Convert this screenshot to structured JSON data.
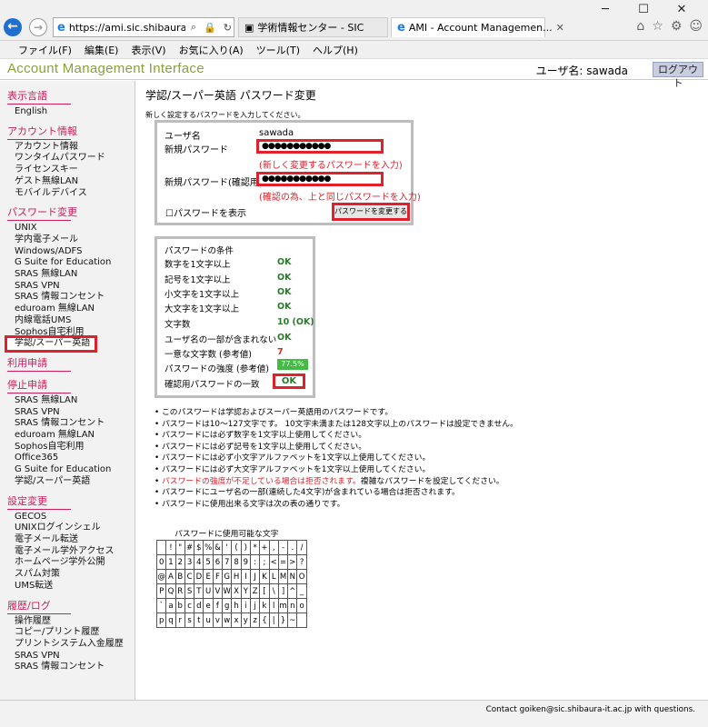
{
  "browser": {
    "window_controls": [
      "─",
      "☐",
      "✕"
    ],
    "address": "https://ami.sic.shibaura...",
    "tabs": [
      {
        "label": "学術情報センター - SIC"
      },
      {
        "label": "AMI - Account Managemen..."
      }
    ],
    "menu": [
      "ファイル(F)",
      "編集(E)",
      "表示(V)",
      "お気に入り(A)",
      "ツール(T)",
      "ヘルプ(H)"
    ]
  },
  "header": {
    "title": "Account Management Interface",
    "user_label": "ユーザ名: sawada",
    "logout": "ログアウト"
  },
  "sidebar": [
    {
      "title": "表示言語",
      "items": [
        "English"
      ]
    },
    {
      "title": "アカウント情報",
      "items": [
        "アカウント情報",
        "ワンタイムパスワード",
        "ライセンスキー",
        "ゲスト無線LAN",
        "モバイルデバイス"
      ]
    },
    {
      "title": "パスワード変更",
      "items": [
        "UNIX",
        "学内電子メール",
        "Windows/ADFS",
        "G Suite for Education",
        "SRAS 無線LAN",
        "SRAS VPN",
        "SRAS 情報コンセント",
        "eduroam 無線LAN",
        "内線電話UMS",
        "Sophos自宅利用",
        "学認/スーパー英語"
      ]
    },
    {
      "title": "利用申請",
      "items": []
    },
    {
      "title": "停止申請",
      "items": [
        "SRAS 無線LAN",
        "SRAS VPN",
        "SRAS 情報コンセント",
        "eduroam 無線LAN",
        "Sophos自宅利用",
        "Office365",
        "G Suite for Education",
        "学認/スーパー英語"
      ]
    },
    {
      "title": "設定変更",
      "items": [
        "GECOS",
        "UNIXログインシェル",
        "電子メール転送",
        "電子メール学外アクセス",
        "ホームページ学外公開",
        "スパム対策",
        "UMS転送"
      ]
    },
    {
      "title": "履歴/ログ",
      "items": [
        "操作履歴",
        "コピー/プリント履歴",
        "プリントシステム入金履歴",
        "SRAS VPN",
        "SRAS 情報コンセント"
      ]
    }
  ],
  "main": {
    "title": "学認/スーパー英語 パスワード変更",
    "instruction": "新しく設定するパスワードを入力してください。",
    "form": {
      "username_label": "ユーザ名",
      "username_value": "sawada",
      "new_pw_label": "新規パスワード",
      "new_pw_value": "●●●●●●●●●●●",
      "new_pw_hint": "(新しく変更するパスワードを入力)",
      "confirm_pw_label": "新規パスワード(確認用)",
      "confirm_pw_value": "●●●●●●●●●●●",
      "confirm_pw_hint": "(確認の為、上と同じパスワードを入力)",
      "show_pw_label": "パスワードを表示",
      "change_button": "パスワードを変更する"
    },
    "conditions": {
      "title": "パスワードの条件",
      "rows": [
        {
          "label": "数字を1文字以上",
          "value": "OK"
        },
        {
          "label": "記号を1文字以上",
          "value": "OK"
        },
        {
          "label": "小文字を1文字以上",
          "value": "OK"
        },
        {
          "label": "大文字を1文字以上",
          "value": "OK"
        },
        {
          "label": "文字数",
          "value": "10 (OK)"
        },
        {
          "label": "ユーザ名の一部が含まれない",
          "value": "OK"
        },
        {
          "label": "一意な文字数 (参考値)",
          "value": "7"
        },
        {
          "label": "パスワードの強度 (参考値)",
          "value": "77.5%"
        },
        {
          "label": "確認用パスワードの一致",
          "value": "OK"
        }
      ]
    },
    "notes": [
      "このパスワードは学認およびスーパー英語用のパスワードです。",
      "パスワードは10～127文字です。 10文字未満または128文字以上のパスワードは設定できません。",
      "パスワードには必ず数字を1文字以上使用してください。",
      "パスワードには必ず記号を1文字以上使用してください。",
      "パスワードには必ず小文字アルファベットを1文字以上使用してください。",
      "パスワードには必ず大文字アルファベットを1文字以上使用してください。",
      "パスワードにユーザ名の一部(連続した4文字)が含まれている場合は拒否されます。",
      "パスワードに使用出来る文字は次の表の通りです。"
    ],
    "warn_note": "パスワードの強度が不足している場合は拒否されます。",
    "warn_note_tail": "複雑なパスワードを設定してください。",
    "chars_title": "パスワードに使用可能な文字",
    "chars": [
      [
        "",
        "!",
        "\"",
        "#",
        "$",
        "%",
        "&",
        "'",
        "(",
        ")",
        "*",
        "+",
        ",",
        "-",
        ".",
        "/"
      ],
      [
        "0",
        "1",
        "2",
        "3",
        "4",
        "5",
        "6",
        "7",
        "8",
        "9",
        ":",
        ";",
        "<",
        "=",
        ">",
        "?"
      ],
      [
        "@",
        "A",
        "B",
        "C",
        "D",
        "E",
        "F",
        "G",
        "H",
        "I",
        "J",
        "K",
        "L",
        "M",
        "N",
        "O"
      ],
      [
        "P",
        "Q",
        "R",
        "S",
        "T",
        "U",
        "V",
        "W",
        "X",
        "Y",
        "Z",
        "[",
        "\\",
        "]",
        "^",
        "_"
      ],
      [
        "`",
        "a",
        "b",
        "c",
        "d",
        "e",
        "f",
        "g",
        "h",
        "i",
        "j",
        "k",
        "l",
        "m",
        "n",
        "o"
      ],
      [
        "p",
        "q",
        "r",
        "s",
        "t",
        "u",
        "v",
        "w",
        "x",
        "y",
        "z",
        "{",
        "|",
        "}",
        "~",
        ""
      ]
    ]
  },
  "footer": "Contact goiken@sic.shibaura-it.ac.jp with questions."
}
